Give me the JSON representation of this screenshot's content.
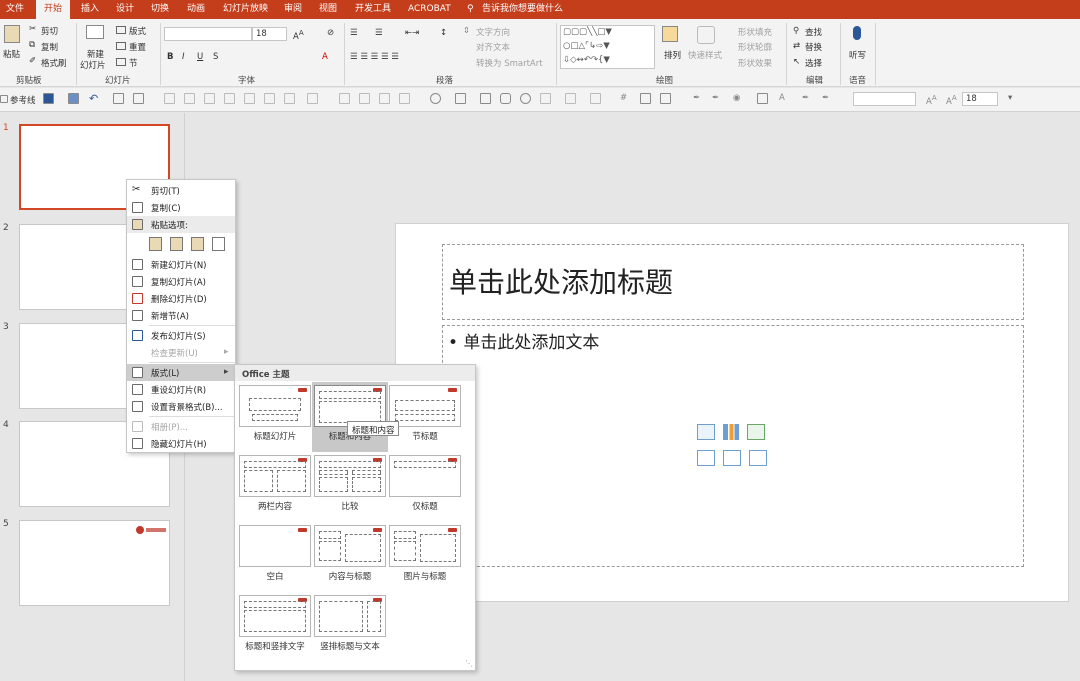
{
  "ribbon_tabs": [
    "文件",
    "开始",
    "插入",
    "设计",
    "切换",
    "动画",
    "幻灯片放映",
    "审阅",
    "视图",
    "开发工具",
    "ACROBAT"
  ],
  "tell_me": "告诉我你想要做什么",
  "clipboard": {
    "paste": "粘贴",
    "cut": "剪切",
    "copy": "复制",
    "format_painter": "格式刷",
    "label": "剪贴板"
  },
  "slides_group": {
    "new_slide_1": "新建",
    "new_slide_2": "幻灯片",
    "layout": "版式",
    "reset": "重置",
    "section": "节",
    "label": "幻灯片"
  },
  "font_group": {
    "font_size": "18",
    "label": "字体"
  },
  "paragraph_group": {
    "text_direction": "文字方向",
    "align_text": "对齐文本",
    "smartart": "转换为 SmartArt",
    "label": "段落"
  },
  "drawing_group": {
    "arrange": "排列",
    "quick_styles": "快速样式",
    "shape_fill": "形状填充",
    "shape_outline": "形状轮廓",
    "shape_effects": "形状效果",
    "label": "绘图"
  },
  "editing_group": {
    "find": "查找",
    "replace": "替换",
    "select": "选择",
    "label": "编辑"
  },
  "voice_group": {
    "dictate": "听写",
    "label": "语音"
  },
  "qat": {
    "guides": "参考线",
    "font_size": "18"
  },
  "slide_numbers": [
    "1",
    "2",
    "3",
    "4",
    "5"
  ],
  "slide": {
    "title_placeholder": "单击此处添加标题",
    "body_placeholder": "• 单击此处添加文本"
  },
  "context_menu": {
    "items": [
      {
        "label": "剪切(T)",
        "icon": "scissors-icon",
        "disabled": false
      },
      {
        "label": "复制(C)",
        "icon": "copy-icon",
        "disabled": false
      },
      {
        "label": "粘贴选项:",
        "icon": "paste-icon",
        "disabled": false
      },
      {
        "label": "新建幻灯片(N)",
        "icon": "new-slide-icon",
        "disabled": false
      },
      {
        "label": "复制幻灯片(A)",
        "icon": "duplicate-slide-icon",
        "disabled": false
      },
      {
        "label": "删除幻灯片(D)",
        "icon": "delete-slide-icon",
        "disabled": false
      },
      {
        "label": "新增节(A)",
        "icon": "section-icon",
        "disabled": false
      },
      {
        "label": "发布幻灯片(S)",
        "icon": "publish-icon",
        "disabled": false
      },
      {
        "label": "检查更新(U)",
        "icon": "",
        "disabled": true
      },
      {
        "label": "版式(L)",
        "icon": "layout-icon",
        "disabled": false
      },
      {
        "label": "重设幻灯片(R)",
        "icon": "reset-icon",
        "disabled": false
      },
      {
        "label": "设置背景格式(B)...",
        "icon": "background-icon",
        "disabled": false
      },
      {
        "label": "相册(P)...",
        "icon": "photo-album-icon",
        "disabled": true
      },
      {
        "label": "隐藏幻灯片(H)",
        "icon": "hide-slide-icon",
        "disabled": false
      }
    ]
  },
  "layout_gallery": {
    "header": "Office 主题",
    "tooltip": "标题和内容",
    "layouts": [
      "标题幻灯片",
      "标题和内容",
      "节标题",
      "两栏内容",
      "比较",
      "仅标题",
      "空白",
      "内容与标题",
      "图片与标题",
      "标题和竖排文字",
      "竖排标题与文本"
    ]
  },
  "colors": {
    "accent": "#c43e1c",
    "selection": "#d24726"
  }
}
